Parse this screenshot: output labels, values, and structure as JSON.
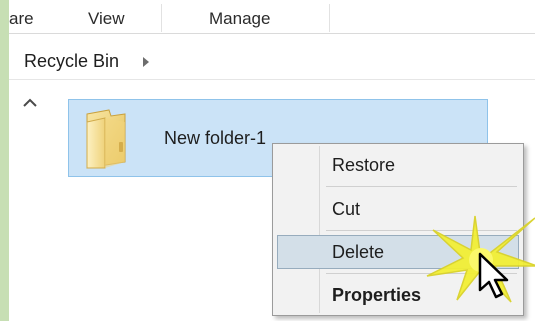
{
  "ribbon": {
    "tabs": [
      "are",
      "View",
      "Manage"
    ]
  },
  "address_bar": {
    "location": "Recycle Bin",
    "chevron_icon": "chevron-right-icon"
  },
  "navigation": {
    "scroll_up_icon": "chevron-up-icon"
  },
  "file_list": {
    "items": [
      {
        "name": "New folder-1",
        "icon": "folder-icon",
        "selected": true
      }
    ]
  },
  "context_menu": {
    "items": [
      {
        "label": "Restore",
        "bold": false,
        "highlighted": false
      },
      {
        "label": "Cut",
        "bold": false,
        "highlighted": false
      },
      {
        "label": "Delete",
        "bold": false,
        "highlighted": true
      },
      {
        "label": "Properties",
        "bold": true,
        "highlighted": false
      }
    ]
  },
  "annotations": {
    "highlight_burst_icon": "yellow-starburst-icon",
    "pointer_icon": "mouse-pointer-icon"
  },
  "colors": {
    "page_frame": "#c7dfb4",
    "selection_fill": "#cbe3f7",
    "selection_border": "#8fc3ea",
    "menu_background": "#f2f2f2",
    "menu_highlight": "#d3dfe8",
    "burst_yellow": "#f2ef35"
  }
}
